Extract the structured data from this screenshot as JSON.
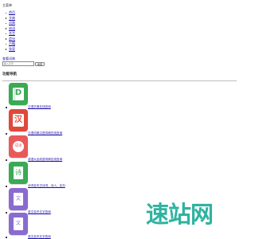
{
  "header": {
    "main_menu": "主菜单"
  },
  "nav": {
    "items": [
      {
        "label": "首页"
      },
      {
        "label": "字典"
      },
      {
        "label": "词典"
      },
      {
        "label": "成语"
      },
      {
        "label": "名言"
      },
      {
        "label": "造句"
      },
      {
        "label": "古籍"
      },
      {
        "label": "答案"
      }
    ]
  },
  "search": {
    "label": "查看词典",
    "placeholder": "输入汉字",
    "button_label": "搜索"
  },
  "functions": {
    "title": "功能导航",
    "items": [
      {
        "label": "汉语字典在线查询",
        "icon": "dictionary-d-icon",
        "glyph": "D",
        "color": "#3aaa55"
      },
      {
        "label": "汉语词典汉语词典在线查询",
        "icon": "han-character-icon",
        "glyph": "汉",
        "color": "#e0493a"
      },
      {
        "label": "成语大全成语词典在线查询",
        "icon": "idiom-icon",
        "glyph": "成语",
        "color": "#e85a5a"
      },
      {
        "label": "诗词名句古诗词、诗人、名句",
        "icon": "poetry-icon",
        "glyph": "诗",
        "color": "#3aaa55"
      },
      {
        "label": "英文名作文字查询",
        "icon": "article-icon",
        "glyph": "文",
        "color": "#8a6bd1"
      },
      {
        "label": "英文名作文字查询",
        "icon": "article-icon",
        "glyph": "文",
        "color": "#8a6bd1"
      }
    ]
  },
  "watermark": {
    "text": "速站网",
    "color_main": "#2eb3a0",
    "color_accent": "#e57a2a"
  }
}
